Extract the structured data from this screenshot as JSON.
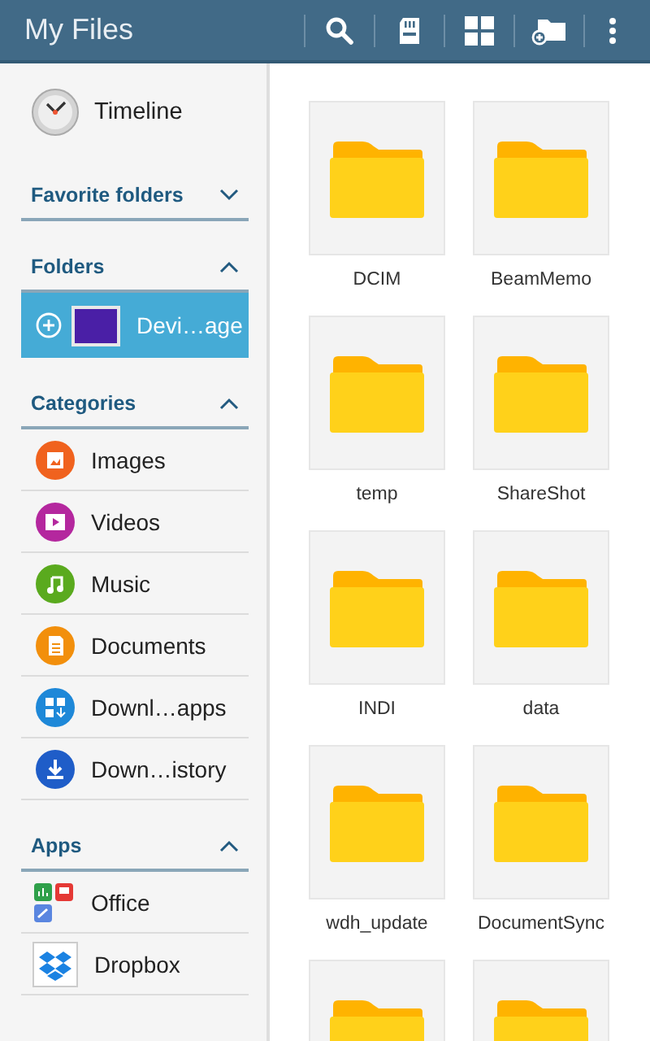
{
  "app_bar": {
    "title": "My Files",
    "actions": [
      {
        "kind": "search"
      },
      {
        "kind": "storage"
      },
      {
        "kind": "grid"
      },
      {
        "kind": "new-folder"
      },
      {
        "kind": "more"
      }
    ]
  },
  "sidebar": {
    "timeline": {
      "label": "Timeline"
    },
    "sections": [
      {
        "title": "Favorite folders",
        "expanded": false
      },
      {
        "title": "Folders",
        "expanded": true,
        "items": [
          {
            "kind": "device",
            "label": "Devi…age",
            "selected": true
          }
        ]
      },
      {
        "title": "Categories",
        "expanded": true,
        "items": [
          {
            "kind": "images",
            "label": "Images",
            "color": "#f0621e",
            "selected": false
          },
          {
            "kind": "videos",
            "label": "Videos",
            "color": "#b4279e",
            "selected": false
          },
          {
            "kind": "music",
            "label": "Music",
            "color": "#5aaa1e",
            "selected": false
          },
          {
            "kind": "documents",
            "label": "Documents",
            "color": "#f28f0c",
            "selected": false
          },
          {
            "kind": "downloaded-apps",
            "label": "Downl…apps",
            "color": "#1e88d8",
            "selected": false
          },
          {
            "kind": "download-history",
            "label": "Down…istory",
            "color": "#1f5dc8",
            "selected": false
          }
        ]
      },
      {
        "title": "Apps",
        "expanded": true,
        "items": [
          {
            "kind": "office",
            "label": "Office",
            "selected": false
          },
          {
            "kind": "dropbox",
            "label": "Dropbox",
            "selected": false
          }
        ]
      }
    ]
  },
  "folders": [
    {
      "kind": "folder",
      "name": "DCIM"
    },
    {
      "kind": "folder",
      "name": "BeamMemo"
    },
    {
      "kind": "folder",
      "name": "temp"
    },
    {
      "kind": "folder",
      "name": "ShareShot"
    },
    {
      "kind": "folder",
      "name": "INDI"
    },
    {
      "kind": "folder",
      "name": "data"
    },
    {
      "kind": "folder",
      "name": "wdh_update"
    },
    {
      "kind": "folder",
      "name": "DocumentSync"
    },
    {
      "kind": "folder"
    },
    {
      "kind": "folder"
    }
  ]
}
